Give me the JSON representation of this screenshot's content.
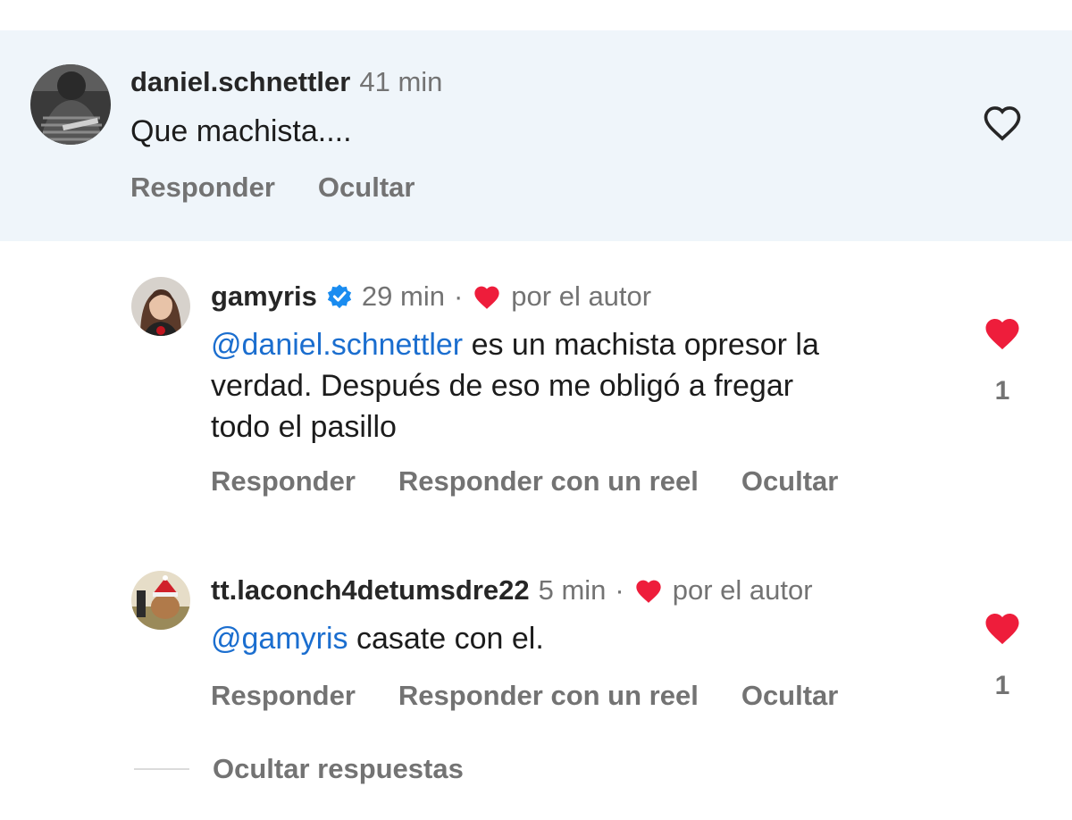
{
  "colors": {
    "parent_bg": "#eff5fa",
    "mention": "#1b6ecf",
    "heart": "#ee1d3b",
    "verified": "#1a8cf0",
    "muted": "#737373"
  },
  "parent": {
    "username": "daniel.schnettler",
    "time": "41 min",
    "text": "Que machista....",
    "actions": {
      "reply": "Responder",
      "hide": "Ocultar"
    },
    "like_icon": "heart-outline-icon"
  },
  "replies": [
    {
      "username": "gamyris",
      "verified": true,
      "time": "29 min",
      "separator": "·",
      "liked_by_author": "por el autor",
      "mention": "@daniel.schnettler",
      "text_line1": " es un machista opresor la",
      "text_line2": "verdad. Después de eso me obligó a fregar",
      "text_line3": "todo el pasillo",
      "likes": "1",
      "actions": {
        "reply": "Responder",
        "reel": "Responder con un reel",
        "hide": "Ocultar"
      }
    },
    {
      "username": "tt.laconch4detumsdre22",
      "verified": false,
      "time": "5 min",
      "separator": "·",
      "liked_by_author": "por el autor",
      "mention": "@gamyris",
      "text_line1": " casate con el.",
      "likes": "1",
      "actions": {
        "reply": "Responder",
        "reel": "Responder con un reel",
        "hide": "Ocultar"
      }
    }
  ],
  "footer": {
    "hide_replies": "Ocultar respuestas"
  }
}
